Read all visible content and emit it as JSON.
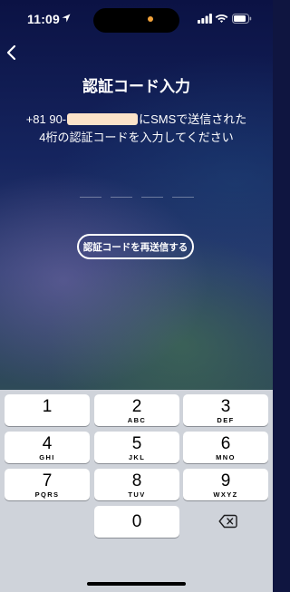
{
  "status_bar": {
    "time": "11:09"
  },
  "header": {
    "title": "認証コード入力"
  },
  "description": {
    "phone_prefix": "+81 90-",
    "line1_suffix": "にSMSで送信された",
    "line2": "4桁の認証コードを入力してください"
  },
  "code_input": {
    "length": 4
  },
  "actions": {
    "resend_label": "認証コードを再送信する"
  },
  "keypad": {
    "keys": [
      {
        "digit": "1",
        "letters": ""
      },
      {
        "digit": "2",
        "letters": "ABC"
      },
      {
        "digit": "3",
        "letters": "DEF"
      },
      {
        "digit": "4",
        "letters": "GHI"
      },
      {
        "digit": "5",
        "letters": "JKL"
      },
      {
        "digit": "6",
        "letters": "MNO"
      },
      {
        "digit": "7",
        "letters": "PQRS"
      },
      {
        "digit": "8",
        "letters": "TUV"
      },
      {
        "digit": "9",
        "letters": "WXYZ"
      },
      {
        "digit": "0",
        "letters": ""
      }
    ]
  },
  "colors": {
    "background_top": "#0b1244",
    "keyboard_bg": "#cfd3da",
    "accent_dot": "#f2a23a",
    "redaction": "#fbe3c9"
  }
}
